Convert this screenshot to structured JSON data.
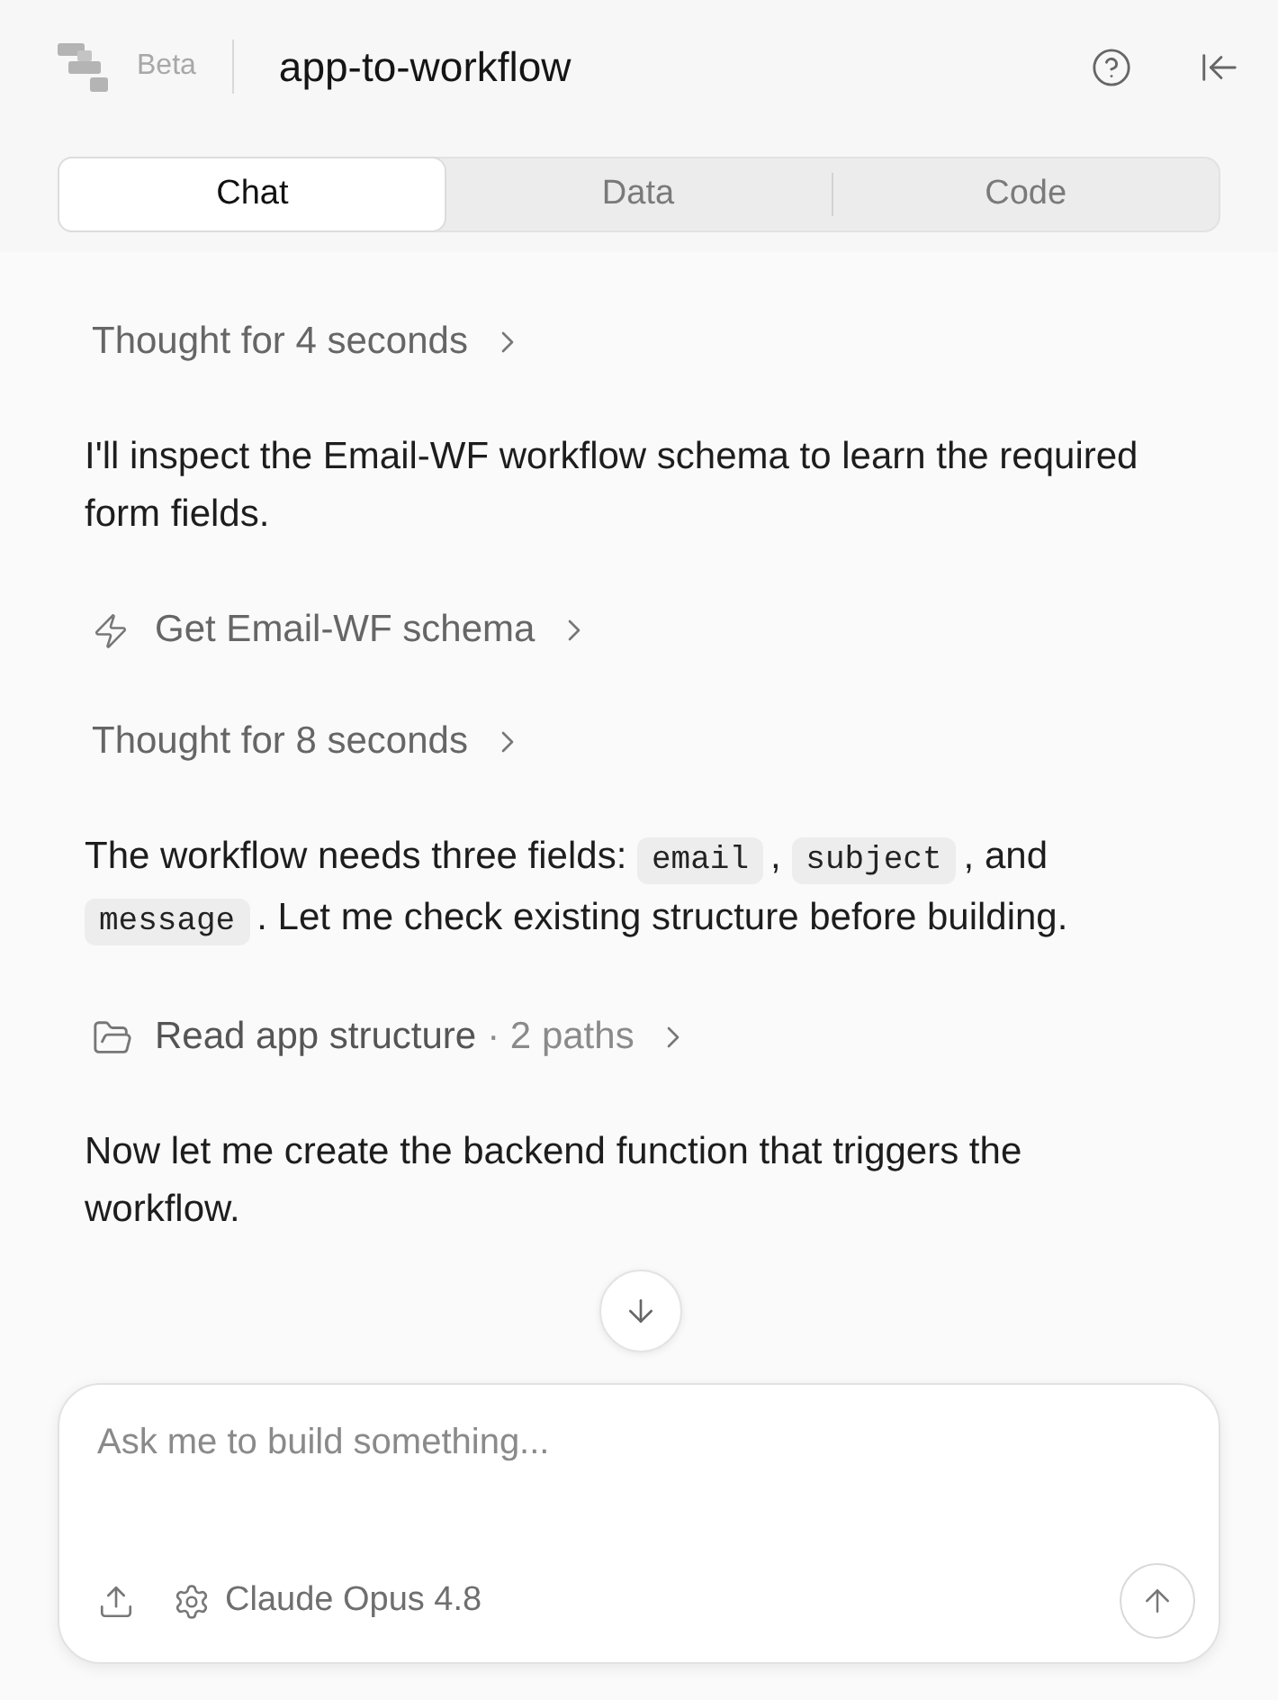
{
  "header": {
    "badge": "Beta",
    "title": "app-to-workflow"
  },
  "tabs": [
    {
      "label": "Chat",
      "selected": true
    },
    {
      "label": "Data",
      "selected": false
    },
    {
      "label": "Code",
      "selected": false
    }
  ],
  "messages": [
    {
      "kind": "thought",
      "label": "Thought for 4 seconds"
    },
    {
      "kind": "text",
      "parts": [
        {
          "kind": "text",
          "text": "I'll inspect the Email-WF workflow schema to learn the required form fields."
        }
      ]
    },
    {
      "kind": "tool",
      "label": "Get Email-WF schema"
    },
    {
      "kind": "thought",
      "label": "Thought for 8 seconds"
    },
    {
      "kind": "text",
      "parts": [
        {
          "kind": "text",
          "text": "The workflow needs three fields: "
        },
        {
          "kind": "code",
          "text": "email"
        },
        {
          "kind": "text",
          "text": ", "
        },
        {
          "kind": "code",
          "text": "subject"
        },
        {
          "kind": "text",
          "text": ", and "
        },
        {
          "kind": "code",
          "text": "message"
        },
        {
          "kind": "text",
          "text": ". Let me check existing structure before building."
        }
      ]
    },
    {
      "kind": "read",
      "label": "Read app structure",
      "detail": "· 2 paths"
    },
    {
      "kind": "text",
      "parts": [
        {
          "kind": "text",
          "text": "Now let me create the backend function that triggers the workflow."
        }
      ]
    }
  ],
  "composer": {
    "placeholder": "Ask me to build something...",
    "model": "Claude Opus 4.8"
  }
}
